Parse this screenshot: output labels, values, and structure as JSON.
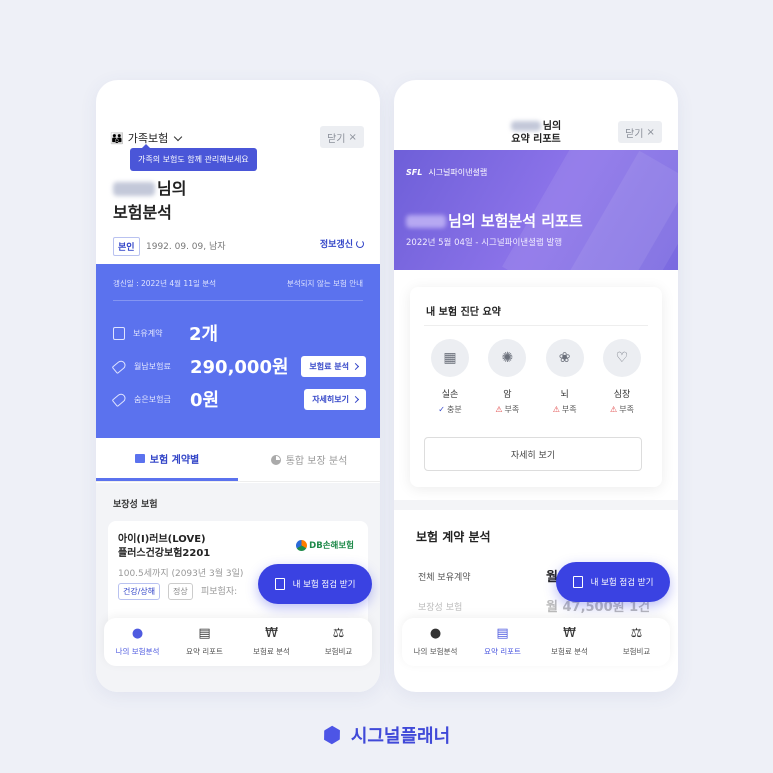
{
  "left": {
    "family_label": "가족보험",
    "close_label": "닫기",
    "tooltip": "가족의 보험도 함께 관리해보세요",
    "name_suffix": "님의",
    "page_title": "보험분석",
    "self_tag": "본인",
    "birth": "1992. 09. 09, 남자",
    "info_update": "정보갱신",
    "panel": {
      "date": "갱신일 : 2022년 4월 11일 분석",
      "unanalyzed_link": "분석되지 않는 보험 안내",
      "rows": [
        {
          "label": "보유계약",
          "value": "2개",
          "button": ""
        },
        {
          "label": "월납보험료",
          "value": "290,000원",
          "button": "보험료 분석"
        },
        {
          "label": "숨은보험금",
          "value": "0원",
          "button": "자세히보기"
        }
      ]
    },
    "tabs": [
      {
        "label": "보험 계약별"
      },
      {
        "label": "통합 보장 분석"
      }
    ],
    "section_title": "보장성 보험",
    "card": {
      "name_line1": "아이(I)러브(LOVE)",
      "name_line2": "플러스건강보험2201",
      "insurer": "DB손해보험",
      "period": "100.5세까지 (2093년 3월 3일)",
      "chip1": "건강/상해",
      "chip2": "정상",
      "insured": "피보험자:"
    },
    "fab": "내 보험 점검 받기",
    "nav": [
      {
        "label": "나의 보험분석",
        "icon": "person-icon",
        "glyph": "●"
      },
      {
        "label": "요약 리포트",
        "icon": "clipboard-icon",
        "glyph": "▤"
      },
      {
        "label": "보험료 분석",
        "icon": "won-icon",
        "glyph": "₩"
      },
      {
        "label": "보험비교",
        "icon": "scale-icon",
        "glyph": "⚖"
      }
    ]
  },
  "right": {
    "title_suffix": "님의",
    "title_line2": "요약 리포트",
    "close_label": "닫기",
    "hero": {
      "brand_logo": "SFL",
      "brand_name": "시그널파이낸셜랩",
      "title": "님의 보험분석 리포트",
      "subtitle": "2022년 5월 04일 - 시그널파이낸셜랩 발행"
    },
    "diagnosis": {
      "title": "내 보험 진단 요약",
      "items": [
        {
          "name": "실손",
          "status": "충분",
          "icon": "hospital-icon",
          "glyph": "▦"
        },
        {
          "name": "암",
          "status": "부족",
          "icon": "cell-icon",
          "glyph": "✺"
        },
        {
          "name": "뇌",
          "status": "부족",
          "icon": "brain-icon",
          "glyph": "❀"
        },
        {
          "name": "심장",
          "status": "부족",
          "icon": "heart-icon",
          "glyph": "♡"
        }
      ],
      "detail_button": "자세히 보기"
    },
    "contract_section": {
      "title": "보험 계약 분석",
      "rows": [
        {
          "label": "전체 보유계약",
          "value": "월"
        },
        {
          "label": "보장성 보험",
          "value": "월 47,500원 1건"
        }
      ]
    },
    "fab": "내 보험 점검 받기",
    "nav": [
      {
        "label": "나의 보험분석"
      },
      {
        "label": "요약 리포트"
      },
      {
        "label": "보험료 분석"
      },
      {
        "label": "보험비교"
      }
    ]
  },
  "brand": "시그널플래너",
  "colors": {
    "accent": "#5b72ee",
    "primary": "#3a42e2",
    "warning": "#e04848"
  }
}
